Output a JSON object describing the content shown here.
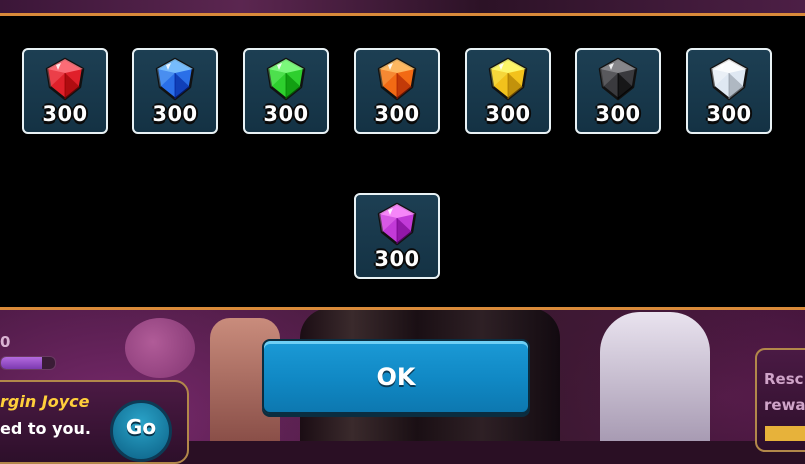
{
  "background": {
    "progress_label": "0",
    "progress_fraction": 0.75,
    "quest_title": "rgin Joyce",
    "quest_subtitle": "ed to you.",
    "go_label": "Go",
    "rescue_line1": "Resc",
    "rescue_line2": "rewa"
  },
  "rewards": [
    {
      "gem": "red-gem",
      "color": "#e0202a",
      "amount": "300"
    },
    {
      "gem": "blue-gem",
      "color": "#2a6fe8",
      "amount": "300"
    },
    {
      "gem": "green-gem",
      "color": "#2ecf2e",
      "amount": "300"
    },
    {
      "gem": "orange-gem",
      "color": "#f26a14",
      "amount": "300"
    },
    {
      "gem": "yellow-gem",
      "color": "#f2c21c",
      "amount": "300"
    },
    {
      "gem": "black-gem",
      "color": "#3a3a3e",
      "amount": "300"
    },
    {
      "gem": "white-gem",
      "color": "#dfe8f2",
      "amount": "300"
    },
    {
      "gem": "purple-gem",
      "color": "#c23ad8",
      "amount": "300"
    }
  ],
  "ok_button": {
    "label": "OK"
  }
}
